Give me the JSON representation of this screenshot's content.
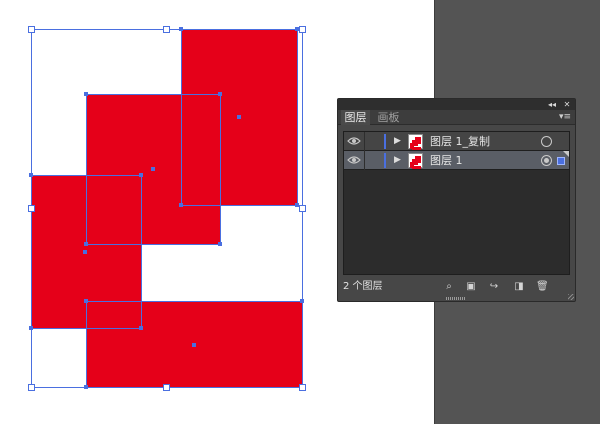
{
  "canvas": {
    "fill_color": "#E50019",
    "selection_color": "#4a6fe0"
  },
  "panel": {
    "collapse_icon": "double-left-arrow",
    "close_icon": "close-x",
    "collapse_glyph": "◂◂",
    "close_glyph": "✕",
    "tabs": [
      {
        "label": "图层",
        "active": true
      },
      {
        "label": "画板",
        "active": false
      }
    ],
    "menu_icon": "panel-menu",
    "menu_glyph": "▾≡",
    "layers": [
      {
        "name": "图层 1_复制",
        "visible": true,
        "expanded": false,
        "color": "#4a6fe0",
        "selected": false
      },
      {
        "name": "图层 1",
        "visible": true,
        "expanded": false,
        "color": "#4a6fe0",
        "selected": true
      }
    ],
    "footer": {
      "count_label": "2 个图层",
      "buttons": [
        "search-icon",
        "make-clipping-mask-icon",
        "new-sublayer-icon",
        "new-layer-icon",
        "delete-icon"
      ]
    }
  }
}
